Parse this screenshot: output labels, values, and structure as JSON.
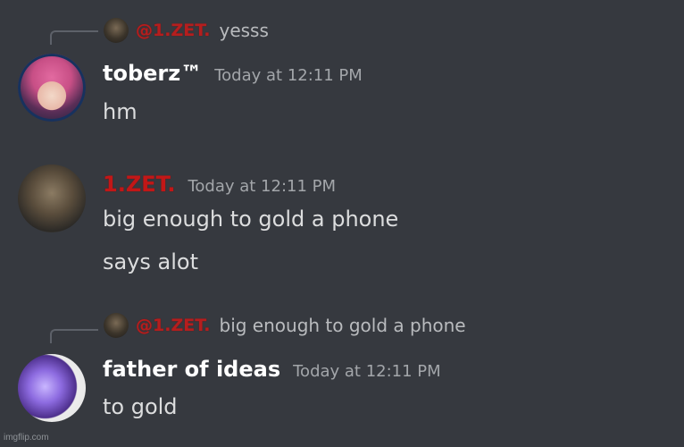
{
  "messages": [
    {
      "reply": {
        "author": "@1.ZET.",
        "text": "yesss"
      },
      "username": "toberz™",
      "timestamp": "Today at 12:11 PM",
      "lines": [
        "hm"
      ]
    },
    {
      "username": "1.ZET.",
      "timestamp": "Today at 12:11 PM",
      "lines": [
        "big enough to gold a phone",
        "says alot"
      ]
    },
    {
      "reply": {
        "author": "@1.ZET.",
        "text": "big enough to gold a phone"
      },
      "username": "father of ideas",
      "timestamp": "Today at 12:11 PM",
      "lines": [
        "to gold"
      ]
    }
  ],
  "watermark": "imgflip.com",
  "colors": {
    "background": "#36393f",
    "zet_name": "#c21717",
    "text": "#dcddde",
    "timestamp": "#a3a6aa"
  }
}
